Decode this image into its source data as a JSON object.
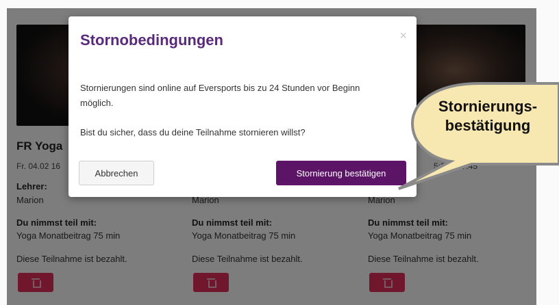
{
  "cards": [
    {
      "title": "FR Yoga",
      "date": "Fr. 04.02 16",
      "teacher_label": "Lehrer:",
      "teacher": "Marion",
      "participate_label": "Du nimmst teil mit:",
      "participate_value": "Yoga Monatbeitrag 75 min",
      "paid_text": "Diese Teilnahme ist bezahlt."
    },
    {
      "title": "",
      "date": "",
      "teacher_label": "",
      "teacher": "Marion",
      "participate_label": "Du nimmst teil mit:",
      "participate_value": "Yoga Monatbeitrag 75 min",
      "paid_text": "Diese Teilnahme ist bezahlt."
    },
    {
      "title": "",
      "date": "5:30 - 17:45",
      "teacher_label": "",
      "teacher": "Marion",
      "participate_label": "Du nimmst teil mit:",
      "participate_value": "Yoga Monatbeitrag 75 min",
      "paid_text": "Diese Teilnahme ist bezahlt."
    }
  ],
  "modal": {
    "title": "Stornobedingungen",
    "close_symbol": "×",
    "policy_text": "Stornierungen sind online auf Eversports bis zu 24 Stunden vor Beginn möglich.",
    "question_text": "Bist du sicher, dass du deine Teilnahme stornieren willst?",
    "cancel_label": "Abbrechen",
    "confirm_label": "Stornierung bestätigen"
  },
  "callout": {
    "line1": "Stornierungs-",
    "line2": "bestätigung"
  },
  "colors": {
    "modal_title": "#5a2a7a",
    "confirm_button": "#5b1466",
    "delete_button": "#e32f5a",
    "callout_fill": "#f7e7b0"
  },
  "icons": {
    "delete": "trash-icon",
    "close": "close-icon"
  }
}
